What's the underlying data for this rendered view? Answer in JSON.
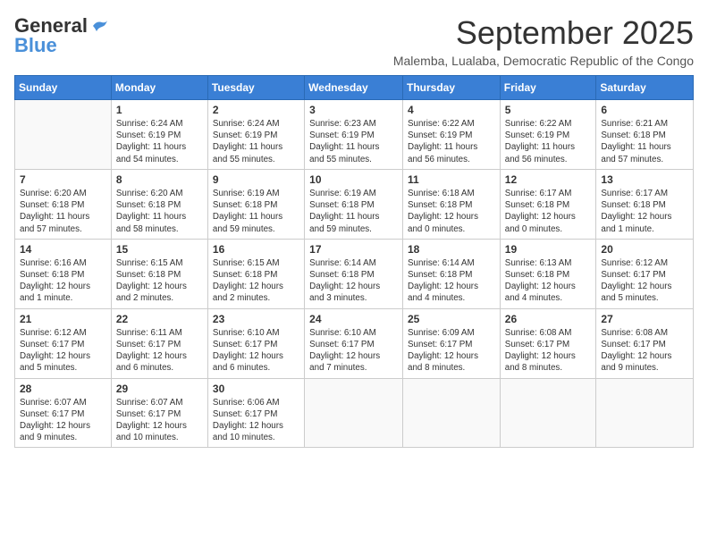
{
  "logo": {
    "line1": "General",
    "line2": "Blue"
  },
  "title": "September 2025",
  "subtitle": "Malemba, Lualaba, Democratic Republic of the Congo",
  "weekdays": [
    "Sunday",
    "Monday",
    "Tuesday",
    "Wednesday",
    "Thursday",
    "Friday",
    "Saturday"
  ],
  "weeks": [
    [
      {
        "day": "",
        "text": ""
      },
      {
        "day": "1",
        "text": "Sunrise: 6:24 AM\nSunset: 6:19 PM\nDaylight: 11 hours\nand 54 minutes."
      },
      {
        "day": "2",
        "text": "Sunrise: 6:24 AM\nSunset: 6:19 PM\nDaylight: 11 hours\nand 55 minutes."
      },
      {
        "day": "3",
        "text": "Sunrise: 6:23 AM\nSunset: 6:19 PM\nDaylight: 11 hours\nand 55 minutes."
      },
      {
        "day": "4",
        "text": "Sunrise: 6:22 AM\nSunset: 6:19 PM\nDaylight: 11 hours\nand 56 minutes."
      },
      {
        "day": "5",
        "text": "Sunrise: 6:22 AM\nSunset: 6:19 PM\nDaylight: 11 hours\nand 56 minutes."
      },
      {
        "day": "6",
        "text": "Sunrise: 6:21 AM\nSunset: 6:18 PM\nDaylight: 11 hours\nand 57 minutes."
      }
    ],
    [
      {
        "day": "7",
        "text": "Sunrise: 6:20 AM\nSunset: 6:18 PM\nDaylight: 11 hours\nand 57 minutes."
      },
      {
        "day": "8",
        "text": "Sunrise: 6:20 AM\nSunset: 6:18 PM\nDaylight: 11 hours\nand 58 minutes."
      },
      {
        "day": "9",
        "text": "Sunrise: 6:19 AM\nSunset: 6:18 PM\nDaylight: 11 hours\nand 59 minutes."
      },
      {
        "day": "10",
        "text": "Sunrise: 6:19 AM\nSunset: 6:18 PM\nDaylight: 11 hours\nand 59 minutes."
      },
      {
        "day": "11",
        "text": "Sunrise: 6:18 AM\nSunset: 6:18 PM\nDaylight: 12 hours\nand 0 minutes."
      },
      {
        "day": "12",
        "text": "Sunrise: 6:17 AM\nSunset: 6:18 PM\nDaylight: 12 hours\nand 0 minutes."
      },
      {
        "day": "13",
        "text": "Sunrise: 6:17 AM\nSunset: 6:18 PM\nDaylight: 12 hours\nand 1 minute."
      }
    ],
    [
      {
        "day": "14",
        "text": "Sunrise: 6:16 AM\nSunset: 6:18 PM\nDaylight: 12 hours\nand 1 minute."
      },
      {
        "day": "15",
        "text": "Sunrise: 6:15 AM\nSunset: 6:18 PM\nDaylight: 12 hours\nand 2 minutes."
      },
      {
        "day": "16",
        "text": "Sunrise: 6:15 AM\nSunset: 6:18 PM\nDaylight: 12 hours\nand 2 minutes."
      },
      {
        "day": "17",
        "text": "Sunrise: 6:14 AM\nSunset: 6:18 PM\nDaylight: 12 hours\nand 3 minutes."
      },
      {
        "day": "18",
        "text": "Sunrise: 6:14 AM\nSunset: 6:18 PM\nDaylight: 12 hours\nand 4 minutes."
      },
      {
        "day": "19",
        "text": "Sunrise: 6:13 AM\nSunset: 6:18 PM\nDaylight: 12 hours\nand 4 minutes."
      },
      {
        "day": "20",
        "text": "Sunrise: 6:12 AM\nSunset: 6:17 PM\nDaylight: 12 hours\nand 5 minutes."
      }
    ],
    [
      {
        "day": "21",
        "text": "Sunrise: 6:12 AM\nSunset: 6:17 PM\nDaylight: 12 hours\nand 5 minutes."
      },
      {
        "day": "22",
        "text": "Sunrise: 6:11 AM\nSunset: 6:17 PM\nDaylight: 12 hours\nand 6 minutes."
      },
      {
        "day": "23",
        "text": "Sunrise: 6:10 AM\nSunset: 6:17 PM\nDaylight: 12 hours\nand 6 minutes."
      },
      {
        "day": "24",
        "text": "Sunrise: 6:10 AM\nSunset: 6:17 PM\nDaylight: 12 hours\nand 7 minutes."
      },
      {
        "day": "25",
        "text": "Sunrise: 6:09 AM\nSunset: 6:17 PM\nDaylight: 12 hours\nand 8 minutes."
      },
      {
        "day": "26",
        "text": "Sunrise: 6:08 AM\nSunset: 6:17 PM\nDaylight: 12 hours\nand 8 minutes."
      },
      {
        "day": "27",
        "text": "Sunrise: 6:08 AM\nSunset: 6:17 PM\nDaylight: 12 hours\nand 9 minutes."
      }
    ],
    [
      {
        "day": "28",
        "text": "Sunrise: 6:07 AM\nSunset: 6:17 PM\nDaylight: 12 hours\nand 9 minutes."
      },
      {
        "day": "29",
        "text": "Sunrise: 6:07 AM\nSunset: 6:17 PM\nDaylight: 12 hours\nand 10 minutes."
      },
      {
        "day": "30",
        "text": "Sunrise: 6:06 AM\nSunset: 6:17 PM\nDaylight: 12 hours\nand 10 minutes."
      },
      {
        "day": "",
        "text": ""
      },
      {
        "day": "",
        "text": ""
      },
      {
        "day": "",
        "text": ""
      },
      {
        "day": "",
        "text": ""
      }
    ]
  ]
}
